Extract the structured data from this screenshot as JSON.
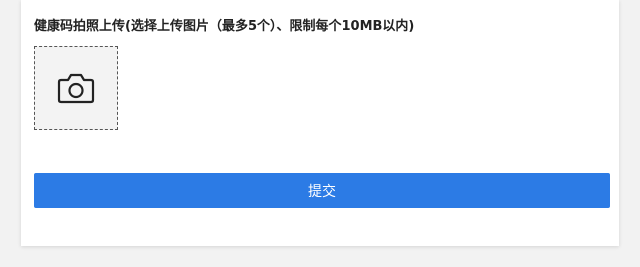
{
  "form": {
    "upload_label": "健康码拍照上传(选择上传图片（最多5个）、限制每个10MB以内)",
    "upload_icon": "camera-icon",
    "submit_label": "提交"
  },
  "colors": {
    "accent": "#2c7be5",
    "upload_bg": "#f3f3f3",
    "page_bg": "#f2f2f2"
  }
}
